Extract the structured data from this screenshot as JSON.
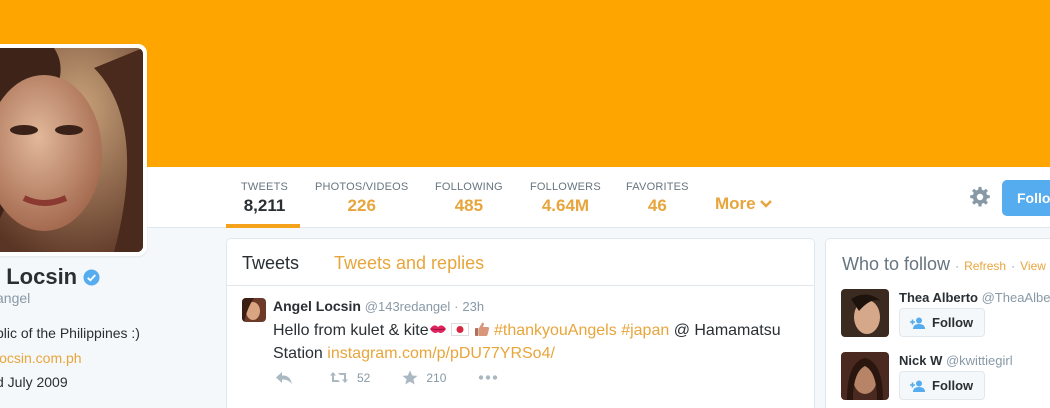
{
  "header": {
    "banner_color": "#FFA500"
  },
  "nav": {
    "stats": [
      {
        "label": "TWEETS",
        "value": "8,211"
      },
      {
        "label": "PHOTOS/VIDEOS",
        "value": "226"
      },
      {
        "label": "FOLLOWING",
        "value": "485"
      },
      {
        "label": "FOLLOWERS",
        "value": "4.64M"
      },
      {
        "label": "FAVORITES",
        "value": "46"
      }
    ],
    "more_label": "More",
    "follow_label": "Follo"
  },
  "profile": {
    "name": "l Locsin",
    "handle": "angel",
    "bio": "blic of the Philippines :)",
    "website": "locsin.com.ph",
    "joined": "d July 2009"
  },
  "timeline": {
    "tabs": {
      "tweets": "Tweets",
      "replies": "Tweets and replies"
    },
    "tweet": {
      "name": "Angel Locsin",
      "handle": "@143redangel",
      "sep": "·",
      "time": "23h",
      "text_before": "Hello from kulet & kite",
      "hashtag1": "#thankyouAngels",
      "hashtag2": "#japan",
      "text_mid": "@ Hamamatsu Station",
      "link": "instagram.com/p/pDU77YRSo4/",
      "retweets": "52",
      "favorites": "210"
    }
  },
  "who_to_follow": {
    "title": "Who to follow",
    "dot": "·",
    "refresh": "Refresh",
    "view": "View",
    "follow_label": "Follow",
    "users": [
      {
        "name": "Thea Alberto",
        "handle": "@TheaAlbe"
      },
      {
        "name": "Nick W",
        "handle": "@kwittiegirl"
      }
    ]
  },
  "colors": {
    "accent": "#E8A53B",
    "active_underline": "#F4A21B",
    "follow_blue": "#55ACEE"
  }
}
